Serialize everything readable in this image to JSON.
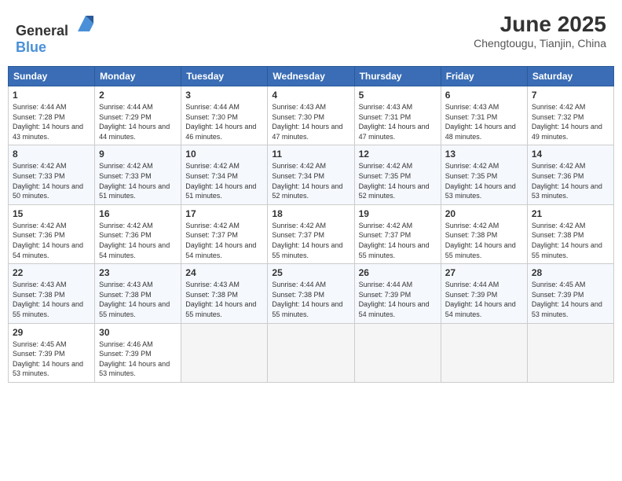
{
  "header": {
    "logo_general": "General",
    "logo_blue": "Blue",
    "month": "June 2025",
    "location": "Chengtougu, Tianjin, China"
  },
  "days_of_week": [
    "Sunday",
    "Monday",
    "Tuesday",
    "Wednesday",
    "Thursday",
    "Friday",
    "Saturday"
  ],
  "weeks": [
    [
      {
        "day": "1",
        "sunrise": "4:44 AM",
        "sunset": "7:28 PM",
        "daylight": "14 hours and 43 minutes."
      },
      {
        "day": "2",
        "sunrise": "4:44 AM",
        "sunset": "7:29 PM",
        "daylight": "14 hours and 44 minutes."
      },
      {
        "day": "3",
        "sunrise": "4:44 AM",
        "sunset": "7:30 PM",
        "daylight": "14 hours and 46 minutes."
      },
      {
        "day": "4",
        "sunrise": "4:43 AM",
        "sunset": "7:30 PM",
        "daylight": "14 hours and 47 minutes."
      },
      {
        "day": "5",
        "sunrise": "4:43 AM",
        "sunset": "7:31 PM",
        "daylight": "14 hours and 47 minutes."
      },
      {
        "day": "6",
        "sunrise": "4:43 AM",
        "sunset": "7:31 PM",
        "daylight": "14 hours and 48 minutes."
      },
      {
        "day": "7",
        "sunrise": "4:42 AM",
        "sunset": "7:32 PM",
        "daylight": "14 hours and 49 minutes."
      }
    ],
    [
      {
        "day": "8",
        "sunrise": "4:42 AM",
        "sunset": "7:33 PM",
        "daylight": "14 hours and 50 minutes."
      },
      {
        "day": "9",
        "sunrise": "4:42 AM",
        "sunset": "7:33 PM",
        "daylight": "14 hours and 51 minutes."
      },
      {
        "day": "10",
        "sunrise": "4:42 AM",
        "sunset": "7:34 PM",
        "daylight": "14 hours and 51 minutes."
      },
      {
        "day": "11",
        "sunrise": "4:42 AM",
        "sunset": "7:34 PM",
        "daylight": "14 hours and 52 minutes."
      },
      {
        "day": "12",
        "sunrise": "4:42 AM",
        "sunset": "7:35 PM",
        "daylight": "14 hours and 52 minutes."
      },
      {
        "day": "13",
        "sunrise": "4:42 AM",
        "sunset": "7:35 PM",
        "daylight": "14 hours and 53 minutes."
      },
      {
        "day": "14",
        "sunrise": "4:42 AM",
        "sunset": "7:36 PM",
        "daylight": "14 hours and 53 minutes."
      }
    ],
    [
      {
        "day": "15",
        "sunrise": "4:42 AM",
        "sunset": "7:36 PM",
        "daylight": "14 hours and 54 minutes."
      },
      {
        "day": "16",
        "sunrise": "4:42 AM",
        "sunset": "7:36 PM",
        "daylight": "14 hours and 54 minutes."
      },
      {
        "day": "17",
        "sunrise": "4:42 AM",
        "sunset": "7:37 PM",
        "daylight": "14 hours and 54 minutes."
      },
      {
        "day": "18",
        "sunrise": "4:42 AM",
        "sunset": "7:37 PM",
        "daylight": "14 hours and 55 minutes."
      },
      {
        "day": "19",
        "sunrise": "4:42 AM",
        "sunset": "7:37 PM",
        "daylight": "14 hours and 55 minutes."
      },
      {
        "day": "20",
        "sunrise": "4:42 AM",
        "sunset": "7:38 PM",
        "daylight": "14 hours and 55 minutes."
      },
      {
        "day": "21",
        "sunrise": "4:42 AM",
        "sunset": "7:38 PM",
        "daylight": "14 hours and 55 minutes."
      }
    ],
    [
      {
        "day": "22",
        "sunrise": "4:43 AM",
        "sunset": "7:38 PM",
        "daylight": "14 hours and 55 minutes."
      },
      {
        "day": "23",
        "sunrise": "4:43 AM",
        "sunset": "7:38 PM",
        "daylight": "14 hours and 55 minutes."
      },
      {
        "day": "24",
        "sunrise": "4:43 AM",
        "sunset": "7:38 PM",
        "daylight": "14 hours and 55 minutes."
      },
      {
        "day": "25",
        "sunrise": "4:44 AM",
        "sunset": "7:38 PM",
        "daylight": "14 hours and 55 minutes."
      },
      {
        "day": "26",
        "sunrise": "4:44 AM",
        "sunset": "7:39 PM",
        "daylight": "14 hours and 54 minutes."
      },
      {
        "day": "27",
        "sunrise": "4:44 AM",
        "sunset": "7:39 PM",
        "daylight": "14 hours and 54 minutes."
      },
      {
        "day": "28",
        "sunrise": "4:45 AM",
        "sunset": "7:39 PM",
        "daylight": "14 hours and 53 minutes."
      }
    ],
    [
      {
        "day": "29",
        "sunrise": "4:45 AM",
        "sunset": "7:39 PM",
        "daylight": "14 hours and 53 minutes."
      },
      {
        "day": "30",
        "sunrise": "4:46 AM",
        "sunset": "7:39 PM",
        "daylight": "14 hours and 53 minutes."
      },
      null,
      null,
      null,
      null,
      null
    ]
  ]
}
